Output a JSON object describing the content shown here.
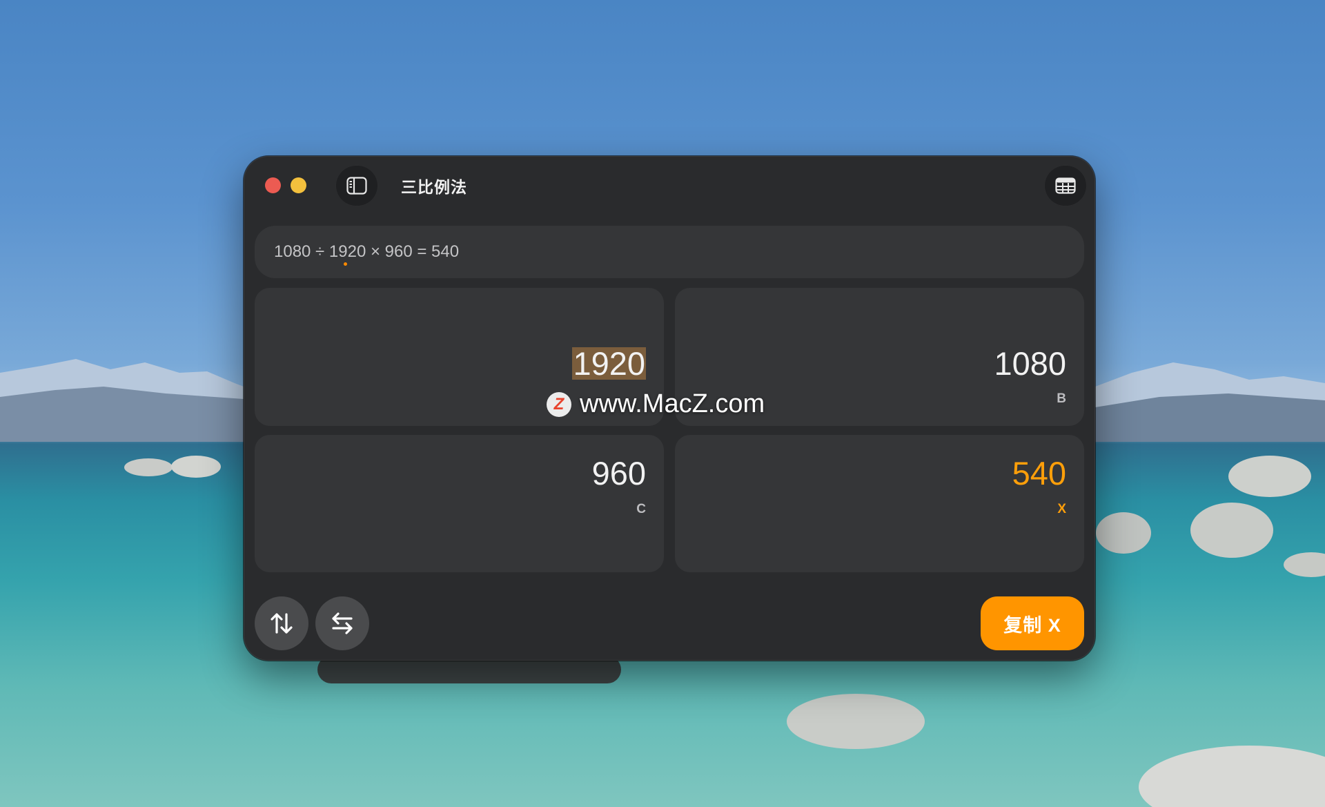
{
  "window": {
    "title": "三比例法"
  },
  "formula": {
    "text": "1080 ÷ 1920 × 960 = 540"
  },
  "cells": {
    "a": {
      "value": "1920",
      "label": ""
    },
    "b": {
      "value": "1080",
      "label": "B"
    },
    "c": {
      "value": "960",
      "label": "C"
    },
    "x": {
      "value": "540",
      "label": "X"
    }
  },
  "buttons": {
    "copy_label": "复制 X"
  },
  "watermark": {
    "logo": "Z",
    "text": "www.MacZ.com"
  },
  "colors": {
    "accent": "#ff9500",
    "result": "#ff9f0a",
    "window_bg": "#2a2b2d",
    "cell_bg": "#353638",
    "selection": "#7b5d3c"
  },
  "icons": {
    "sidebar": "sidebar-icon",
    "table": "table-icon",
    "swap_vertical": "swap-vertical-icon",
    "swap_horizontal": "swap-horizontal-icon"
  }
}
